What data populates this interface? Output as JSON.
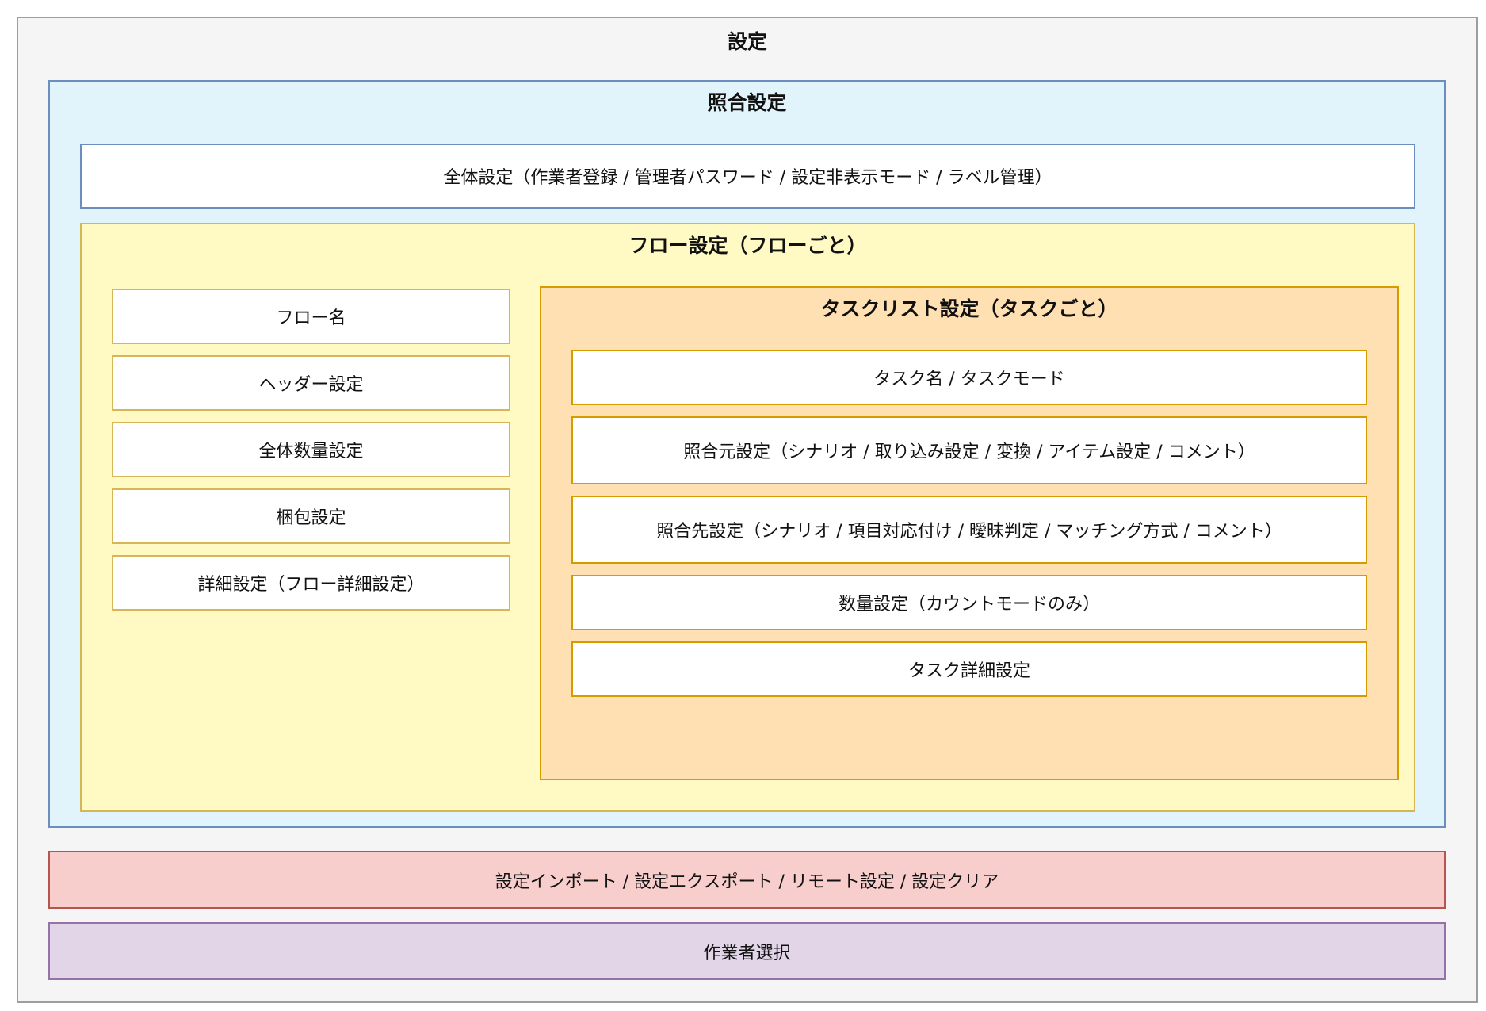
{
  "diagram": {
    "root_title": "設定",
    "collation": {
      "title": "照合設定",
      "global_settings": "全体設定（作業者登録 / 管理者パスワード / 設定非表示モード / ラベル管理）",
      "flow": {
        "title": "フロー設定（フローごと）",
        "items": [
          "フロー名",
          "ヘッダー設定",
          "全体数量設定",
          "梱包設定",
          "詳細設定（フロー詳細設定）"
        ],
        "tasklist": {
          "title": "タスクリスト設定（タスクごと）",
          "items": [
            "タスク名 / タスクモード",
            "照合元設定（シナリオ / 取り込み設定 / 変換 / アイテム設定 / コメント）",
            "照合先設定（シナリオ / 項目対応付け / 曖昧判定 / マッチング方式 / コメント）",
            "数量設定（カウントモードのみ）",
            "タスク詳細設定"
          ]
        }
      }
    },
    "import_export": "設定インポート / 設定エクスポート / リモート設定 / 設定クリア",
    "worker_select": "作業者選択"
  },
  "colors": {
    "outer_fill": "#f5f5f5",
    "collation_fill": "#e1f4fc",
    "flow_fill": "#fff9c4",
    "tasklist_fill": "#ffe0b2",
    "import_fill": "#f8cecc",
    "worker_fill": "#e1d5e7"
  }
}
